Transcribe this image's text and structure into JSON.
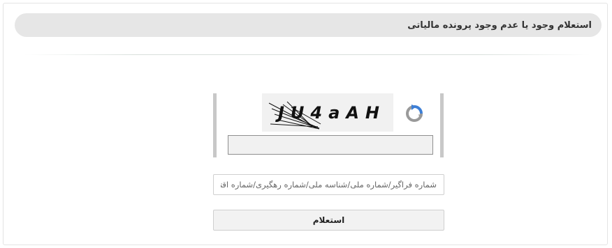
{
  "page": {
    "title": "استعلام وجود یا عدم وجود پرونده مالیاتی"
  },
  "captcha": {
    "text": "JU4aAH",
    "input_value": "",
    "refresh_icon": "refresh-icon"
  },
  "form": {
    "id_placeholder": "شماره فراگیر/شماره ملی/شناسه ملی/شماره رهگیری/شماره اقتصادی",
    "id_value": "",
    "submit_label": "استعلام"
  },
  "colors": {
    "title_bar_bg": "#e6e6e6",
    "captcha_border": "#c8c8c8",
    "refresh_blue": "#3d7fd6",
    "refresh_gray": "#9a9a9a"
  }
}
